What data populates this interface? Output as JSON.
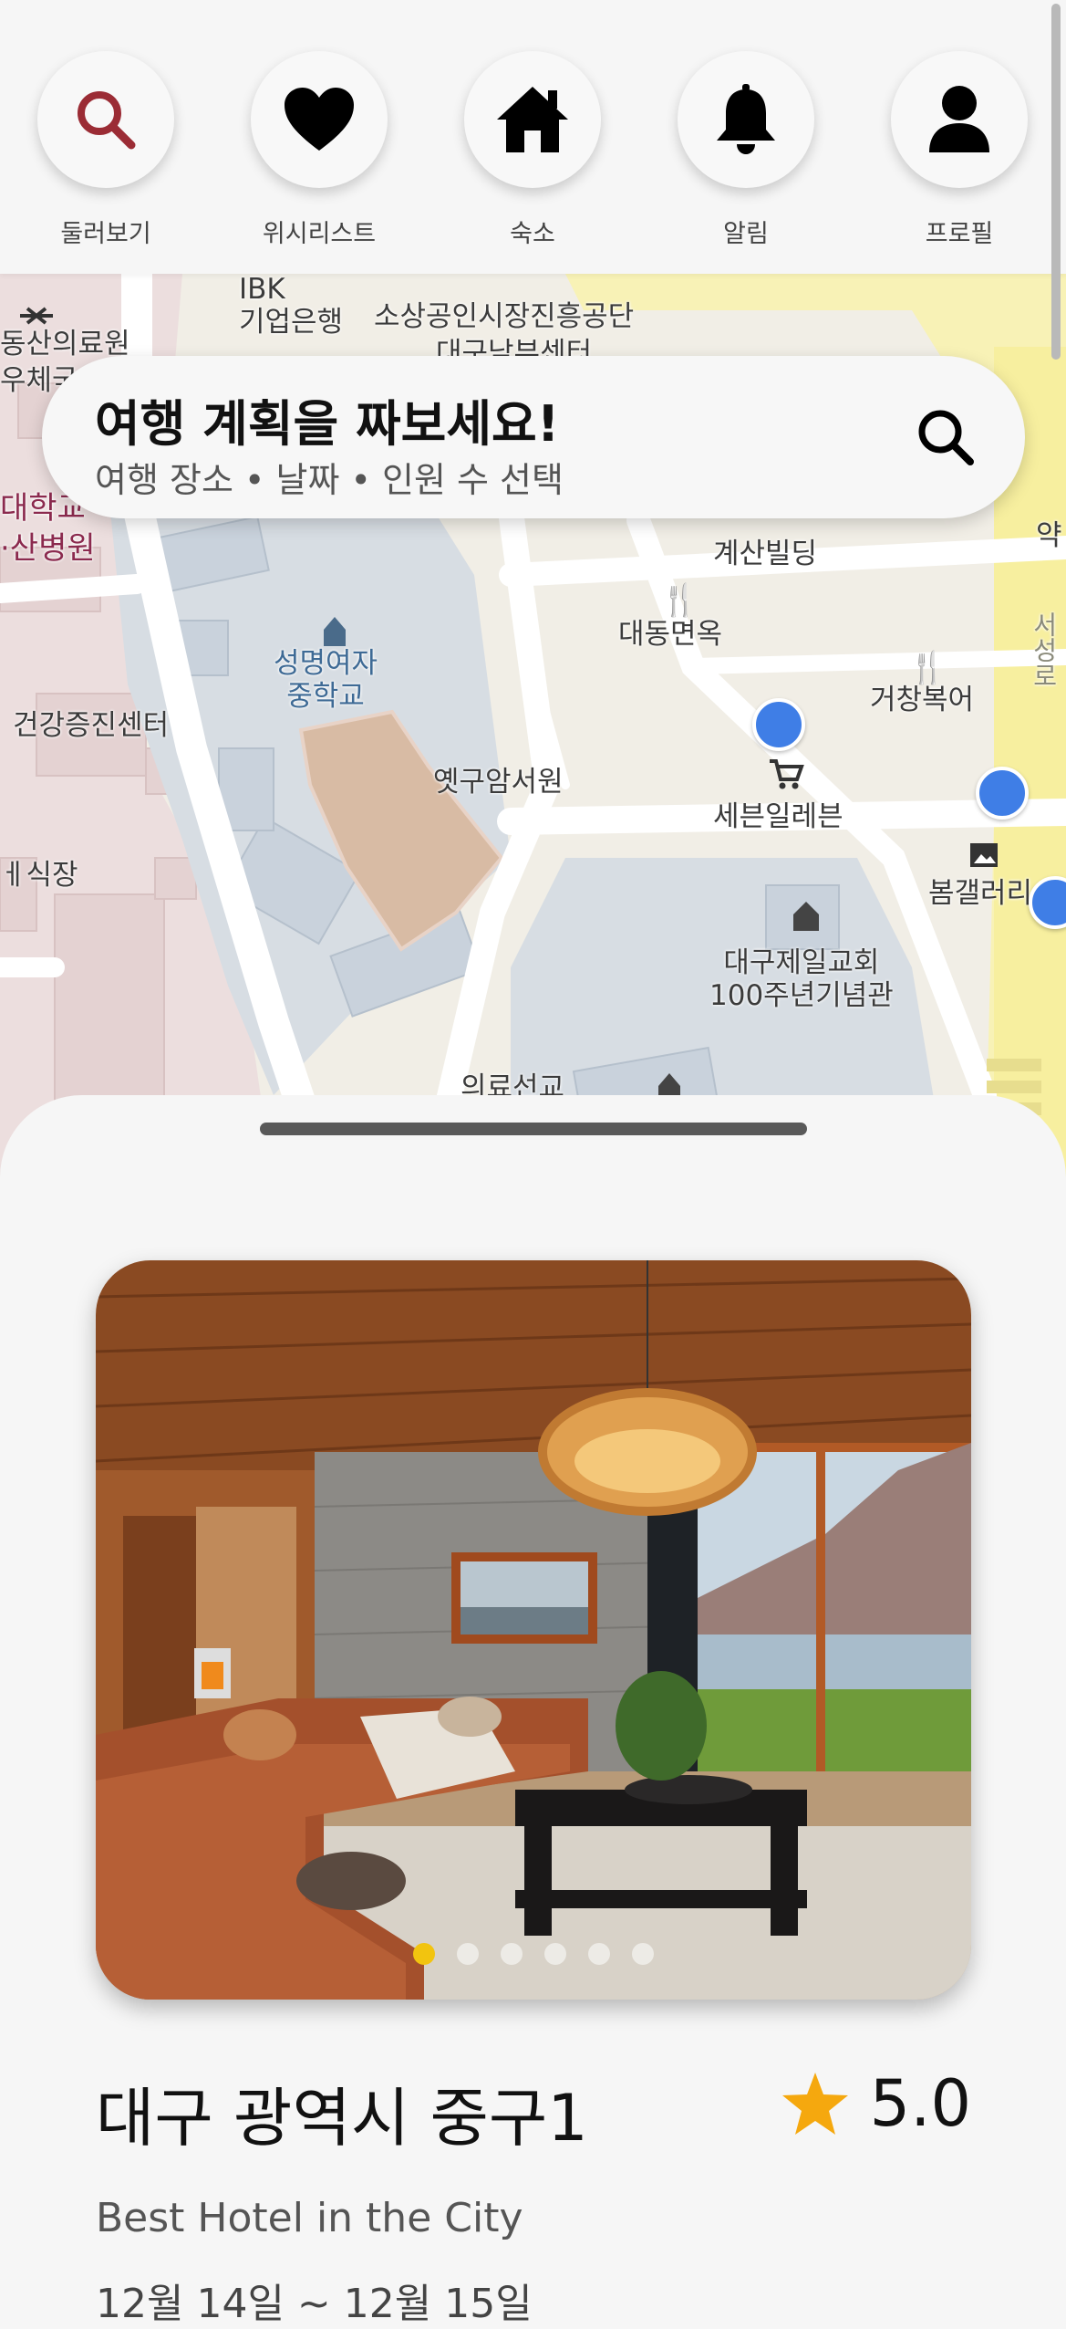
{
  "nav": {
    "items": [
      {
        "icon": "search-icon",
        "label": "둘러보기",
        "active_color": "#9b2c35"
      },
      {
        "icon": "heart-icon",
        "label": "위시리스트"
      },
      {
        "icon": "home-icon",
        "label": "숙소"
      },
      {
        "icon": "bell-icon",
        "label": "알림"
      },
      {
        "icon": "person-icon",
        "label": "프로필"
      }
    ]
  },
  "map": {
    "labels": {
      "ibk": "IBK\n기업은행",
      "sosang": "소상공인시장진흥공단",
      "sosang2": "대구남부센터",
      "dongsan": "동산의료원",
      "wuche": "우체국",
      "univ": "대학교",
      "hospital": "·산병원",
      "seongmyeong": "성명여자\n중학교",
      "health": "건강증진센터",
      "oldpost": "옛구암서원",
      "restaurant": "ㅔ식장",
      "gyesan": "계산빌딩",
      "daedong": "대동면옥",
      "geochang": "거창복어",
      "seven": "세븐일레븐",
      "gallery": "봄갤러리",
      "church": "대구제일교회\n100주년기념관",
      "hospital2": "의료선교",
      "yak": "약",
      "seoseong": "서성로"
    }
  },
  "search": {
    "title": "여행 계획을 짜보세요!",
    "subtitle": "여행 장소 • 날짜 • 인원 수 선택"
  },
  "listing": {
    "title": "대구 광역시 중구1",
    "rating": "5.0",
    "subtitle": "Best Hotel in the City",
    "dates": "12월 14일 ~ 12월 15일",
    "photo_count": 6,
    "active_photo": 1,
    "star_color": "#f5a80e"
  }
}
